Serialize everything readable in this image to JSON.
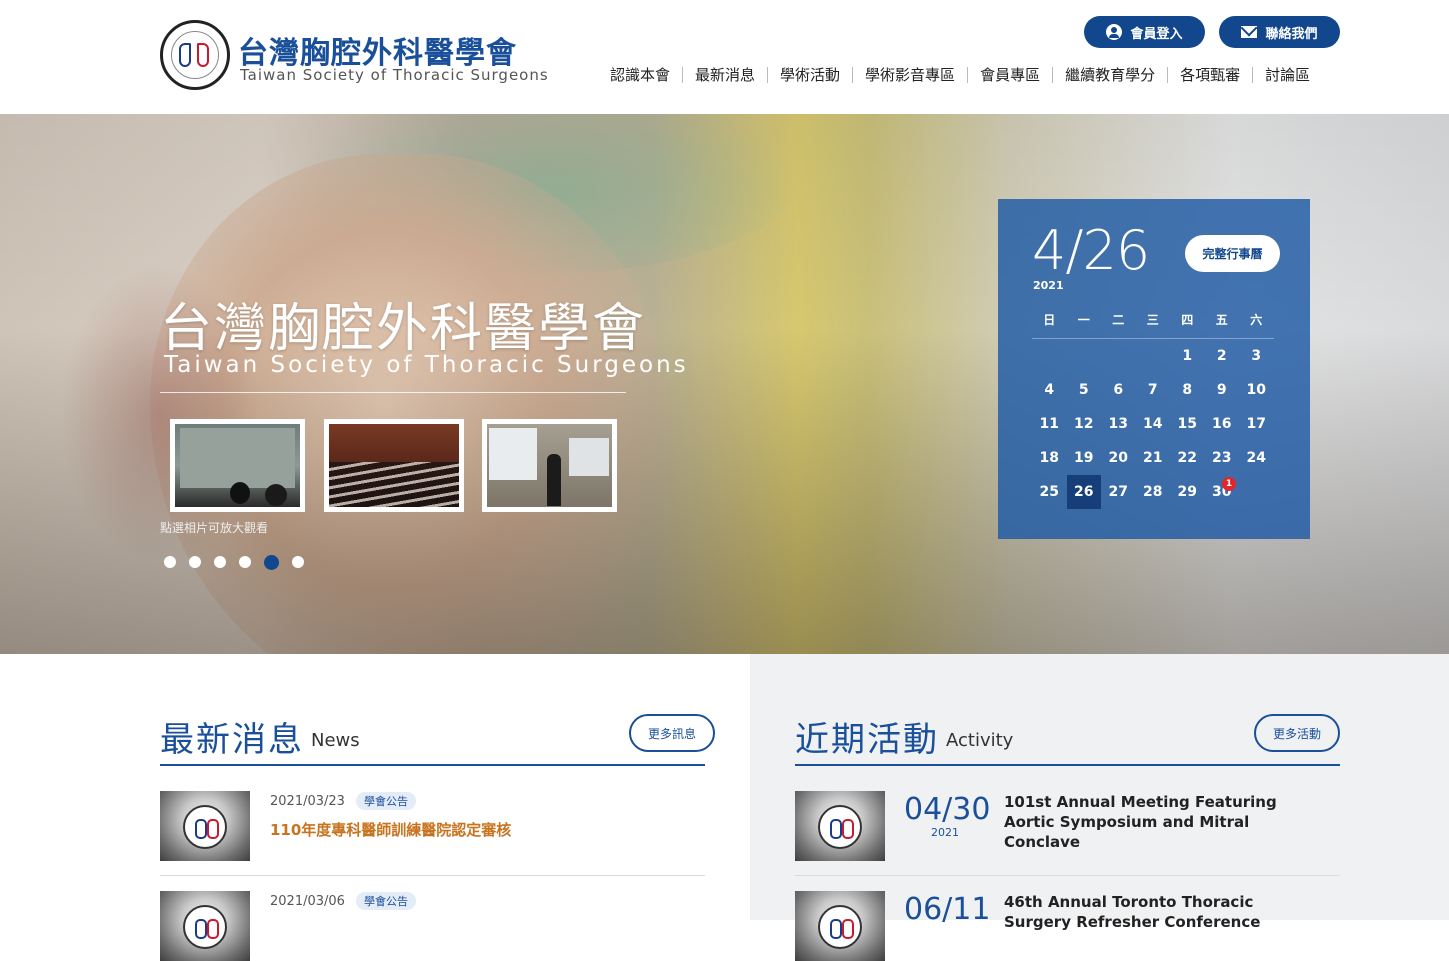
{
  "header": {
    "title_zh": "台灣胸腔外科醫學會",
    "title_en": "Taiwan Society of Thoracic Surgeons",
    "login_label": "會員登入",
    "contact_label": "聯絡我們",
    "nav": [
      "認識本會",
      "最新消息",
      "學術活動",
      "學術影音專區",
      "會員專區",
      "繼續教育學分",
      "各項甄審",
      "討論區"
    ]
  },
  "hero": {
    "title_zh": "台灣胸腔外科醫學會",
    "title_en": "Taiwan Society of Thoracic Surgeons",
    "thumb_caption": "點選相片可放大觀看",
    "slide_count": 6,
    "active_slide": 5
  },
  "calendar": {
    "date": "4/26",
    "year": "2021",
    "full_button": "完整行事曆",
    "weekdays": [
      "日",
      "一",
      "二",
      "三",
      "四",
      "五",
      "六"
    ],
    "days": [
      "",
      "",
      "",
      "",
      "1",
      "2",
      "3",
      "4",
      "5",
      "6",
      "7",
      "8",
      "9",
      "10",
      "11",
      "12",
      "13",
      "14",
      "15",
      "16",
      "17",
      "18",
      "19",
      "20",
      "21",
      "22",
      "23",
      "24",
      "25",
      "26",
      "27",
      "28",
      "29",
      "30",
      ""
    ],
    "today": "26",
    "event_day": "30",
    "event_count": "1"
  },
  "news": {
    "title": "最新消息",
    "title_en": "News",
    "more_label": "更多訊息",
    "items": [
      {
        "date": "2021/03/23",
        "tag": "學會公告",
        "title": "110年度專科醫師訓練醫院認定審核"
      },
      {
        "date": "2021/03/06",
        "tag": "學會公告",
        "title": ""
      }
    ]
  },
  "activity": {
    "title": "近期活動",
    "title_en": "Activity",
    "more_label": "更多活動",
    "items": [
      {
        "date": "04/30",
        "year": "2021",
        "title": "101st Annual Meeting Featuring Aortic Symposium and Mitral Conclave"
      },
      {
        "date": "06/11",
        "year": "",
        "title": "46th Annual Toronto Thoracic Surgery Refresher Conference"
      }
    ]
  },
  "colors": {
    "brand_blue": "#12478e",
    "title_blue": "#1a4f9a",
    "news_orange": "#c8741f",
    "badge_red": "#e2262b"
  },
  "icons": {
    "login": "user-circle-icon",
    "contact": "mail-icon"
  }
}
